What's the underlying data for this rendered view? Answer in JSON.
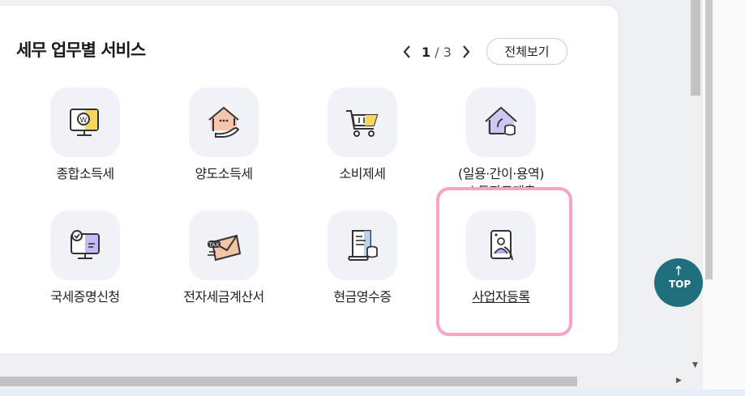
{
  "section": {
    "title": "세무 업무별 서비스",
    "pager": {
      "current": "1",
      "separator": "/",
      "total": "3"
    },
    "view_all_label": "전체보기"
  },
  "services": [
    {
      "label": "종합소득세",
      "icon": "monitor-won-icon"
    },
    {
      "label": "양도소득세",
      "icon": "house-hand-icon"
    },
    {
      "label": "소비제세",
      "icon": "shopping-cart-icon"
    },
    {
      "label": "(일용·간이·용역)",
      "label2": "소득자료제출",
      "icon": "house-coins-icon"
    },
    {
      "label": "국세증명신청",
      "icon": "monitor-certificate-icon"
    },
    {
      "label": "전자세금계산서",
      "icon": "tax-envelope-icon"
    },
    {
      "label": "현금영수증",
      "icon": "receipt-coins-icon"
    },
    {
      "label": "사업자등록",
      "icon": "id-card-icon"
    }
  ],
  "top_button": {
    "arrow": "↑",
    "label": "TOP"
  },
  "colors": {
    "accent_teal": "#1f6f7e",
    "highlight_pink": "#f7a5c6",
    "icon_yellow": "#f6d65c",
    "icon_purple": "#b9a8f0",
    "icon_orange": "#f6b48a"
  }
}
